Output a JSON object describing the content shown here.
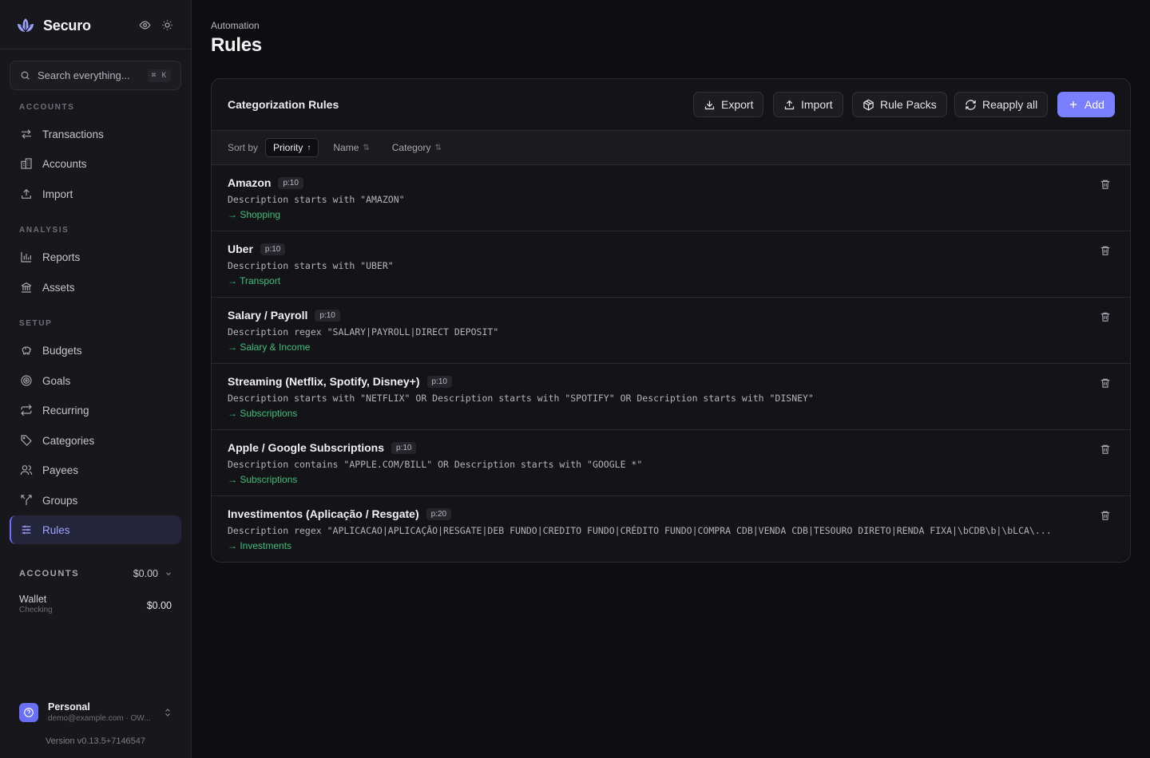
{
  "app": {
    "name": "Securo"
  },
  "search": {
    "placeholder": "Search everything...",
    "shortcut": "⌘ K"
  },
  "sidebar": {
    "sections": [
      {
        "label": "ACCOUNTS"
      },
      {
        "label": "ANALYSIS"
      },
      {
        "label": "SETUP"
      }
    ],
    "items": [
      {
        "label": "Transactions"
      },
      {
        "label": "Accounts"
      },
      {
        "label": "Import"
      },
      {
        "label": "Reports"
      },
      {
        "label": "Assets"
      },
      {
        "label": "Budgets"
      },
      {
        "label": "Goals"
      },
      {
        "label": "Recurring"
      },
      {
        "label": "Categories"
      },
      {
        "label": "Payees"
      },
      {
        "label": "Groups"
      },
      {
        "label": "Rules"
      }
    ],
    "accounts_summary": {
      "label": "ACCOUNTS",
      "total": "$0.00"
    },
    "wallet": {
      "name": "Wallet",
      "type": "Checking",
      "balance": "$0.00"
    },
    "profile": {
      "name": "Personal",
      "email": "demo@example.com · OW..."
    },
    "version": "Version v0.13.5+7146547"
  },
  "page": {
    "breadcrumb": "Automation",
    "title": "Rules"
  },
  "card": {
    "title": "Categorization Rules",
    "buttons": {
      "export": "Export",
      "import": "Import",
      "rule_packs": "Rule Packs",
      "reapply": "Reapply all",
      "add": "Add"
    },
    "sort": {
      "label": "Sort by",
      "options": [
        {
          "label": "Priority",
          "arrow": "↑"
        },
        {
          "label": "Name",
          "arrow": "⇅"
        },
        {
          "label": "Category",
          "arrow": "⇅"
        }
      ]
    }
  },
  "rules": [
    {
      "name": "Amazon",
      "priority": "p:10",
      "description": "Description starts with \"AMAZON\"",
      "category": "→ Shopping"
    },
    {
      "name": "Uber",
      "priority": "p:10",
      "description": "Description starts with \"UBER\"",
      "category": "→ Transport"
    },
    {
      "name": "Salary / Payroll",
      "priority": "p:10",
      "description": "Description regex \"SALARY|PAYROLL|DIRECT DEPOSIT\"",
      "category": "→ Salary & Income"
    },
    {
      "name": "Streaming (Netflix, Spotify, Disney+)",
      "priority": "p:10",
      "description": "Description starts with \"NETFLIX\" OR Description starts with \"SPOTIFY\" OR Description starts with \"DISNEY\"",
      "category": "→ Subscriptions"
    },
    {
      "name": "Apple / Google Subscriptions",
      "priority": "p:10",
      "description": "Description contains \"APPLE.COM/BILL\" OR Description starts with \"GOOGLE *\"",
      "category": "→ Subscriptions"
    },
    {
      "name": "Investimentos (Aplicação / Resgate)",
      "priority": "p:20",
      "description": "Description regex \"APLICACAO|APLICAÇÃO|RESGATE|DEB FUNDO|CREDITO FUNDO|CRÉDITO FUNDO|COMPRA CDB|VENDA CDB|TESOURO DIRETO|RENDA FIXA|\\bCDB\\b|\\bLCA\\...",
      "category": "→ Investments"
    }
  ],
  "colors": {
    "accent": "#7a7fff",
    "category": "#3dbf7a",
    "background": "#0e0e11"
  }
}
